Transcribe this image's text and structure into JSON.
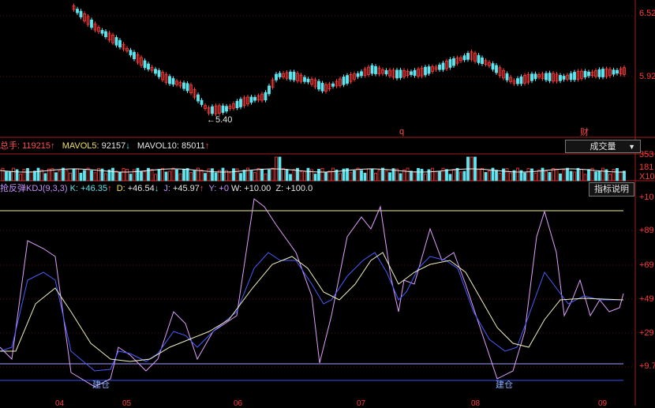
{
  "price_panel": {
    "axis_labels": [
      "6.52",
      "5.92"
    ],
    "low_annotation": "5.40",
    "event_markers": [
      "q",
      "财"
    ]
  },
  "volume_panel": {
    "total_prefix": "总手:",
    "total_value": "119215",
    "mavol5_label": "MAVOL5:",
    "mavol5_value": "92157",
    "mavol10_label": "MAVOL10:",
    "mavol10_value": "85011",
    "axis_labels": [
      "353",
      "181",
      "X10"
    ],
    "indicator_select": "成交量",
    "colors": {
      "up": "#ff3b3b",
      "down": "#5ee6f0"
    }
  },
  "kdj_panel": {
    "name": "抢反弹KDJ(9,3,3)",
    "k_label": "K:",
    "k_value": "+46.35",
    "d_label": "D:",
    "d_value": "+46.54",
    "j_label": "J:",
    "j_value": "+45.97",
    "y_label": "Y:",
    "y_value": "+0",
    "w_label": "W:",
    "w_value": "+10.00",
    "z_label": "Z:",
    "z_value": "+100.0",
    "explain_button": "指标说明",
    "axis_labels": [
      "+10",
      "+89",
      "+69",
      "+49",
      "+29",
      "+9.7"
    ],
    "signals": [
      "建仓",
      "建仓"
    ],
    "date_labels": [
      "04",
      "05",
      "06",
      "07",
      "08",
      "09"
    ],
    "colors": {
      "k": "#4a5cff",
      "d": "#f0f0c0",
      "j": "#e0a0ff",
      "upper_line": "#f0f0a0",
      "w_line": "#a0a0ff",
      "y_line": "#3050ff"
    }
  }
}
